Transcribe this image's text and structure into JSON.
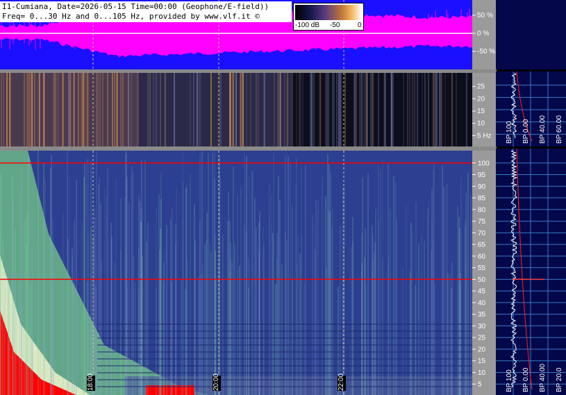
{
  "header": {
    "line1": "I1-Cumiana, Date=2026-05-15 Time=00:00 (Geophone/E-field))",
    "line2": "Freq= 0...30 Hz and 0...105 Hz, provided by www.vlf.it ©"
  },
  "colorbar": {
    "min_label": "-100 dB",
    "mid_label": "-50",
    "max_label": "0"
  },
  "colors": {
    "waveform_bg": "#1a10ff",
    "waveform_signal": "#ff00ff",
    "spectrogram_low_bg": "#2c3f90",
    "spectrogram_hot": "#ff0000",
    "sideband_bg": "#04084a",
    "scale_bg": "#9a9a9a"
  },
  "chart_data": [
    {
      "type": "line",
      "panel": "waveform",
      "y_tick_labels": [
        "50 %",
        "0 %",
        "-50 %"
      ],
      "y_ticks": [
        50,
        0,
        -50
      ],
      "ylim": [
        -100,
        100
      ]
    },
    {
      "type": "heatmap",
      "panel": "spectrogram-0-30Hz",
      "y_tick_labels": [
        "25",
        "20",
        "15",
        "10",
        "5 Hz"
      ],
      "y_ticks": [
        25,
        20,
        15,
        10,
        5
      ],
      "ylim": [
        0,
        30
      ]
    },
    {
      "type": "heatmap",
      "panel": "spectrogram-0-105Hz",
      "y_tick_labels": [
        "100",
        "95",
        "90",
        "85",
        "80",
        "75",
        "70",
        "65",
        "60",
        "55",
        "50",
        "45",
        "40",
        "35",
        "30",
        "25",
        "20",
        "15",
        "10",
        "5"
      ],
      "y_ticks": [
        100,
        95,
        90,
        85,
        80,
        75,
        70,
        65,
        60,
        55,
        50,
        45,
        40,
        35,
        30,
        25,
        20,
        15,
        10,
        5
      ],
      "ylim": [
        0,
        105
      ],
      "x_tick_labels": [
        "18:00",
        "20:00",
        "22:00"
      ],
      "hum_lines_hz": [
        100,
        50
      ]
    }
  ],
  "side_labels": {
    "upper": [
      "BP 100",
      "BP 0.00",
      "BP 40.00",
      "BP 60.00"
    ],
    "lower": [
      "BP 100",
      "BP 0.00",
      "BP 40.00",
      "BP 20.0"
    ]
  }
}
